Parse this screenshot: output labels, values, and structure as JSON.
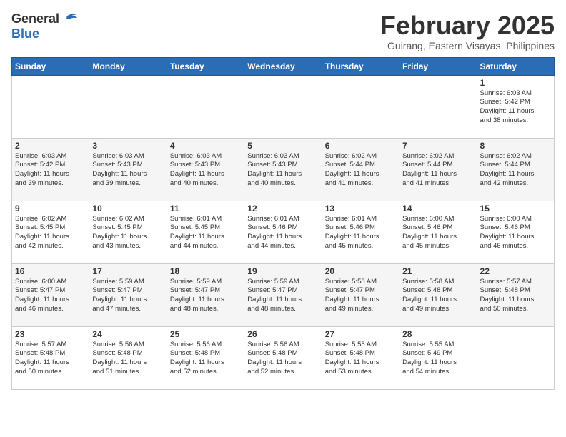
{
  "header": {
    "logo": {
      "general": "General",
      "blue": "Blue"
    },
    "title": "February 2025",
    "location": "Guirang, Eastern Visayas, Philippines"
  },
  "weekdays": [
    "Sunday",
    "Monday",
    "Tuesday",
    "Wednesday",
    "Thursday",
    "Friday",
    "Saturday"
  ],
  "weeks": [
    [
      {
        "day": "",
        "info": ""
      },
      {
        "day": "",
        "info": ""
      },
      {
        "day": "",
        "info": ""
      },
      {
        "day": "",
        "info": ""
      },
      {
        "day": "",
        "info": ""
      },
      {
        "day": "",
        "info": ""
      },
      {
        "day": "1",
        "info": "Sunrise: 6:03 AM\nSunset: 5:42 PM\nDaylight: 11 hours\nand 38 minutes."
      }
    ],
    [
      {
        "day": "2",
        "info": "Sunrise: 6:03 AM\nSunset: 5:42 PM\nDaylight: 11 hours\nand 39 minutes."
      },
      {
        "day": "3",
        "info": "Sunrise: 6:03 AM\nSunset: 5:43 PM\nDaylight: 11 hours\nand 39 minutes."
      },
      {
        "day": "4",
        "info": "Sunrise: 6:03 AM\nSunset: 5:43 PM\nDaylight: 11 hours\nand 40 minutes."
      },
      {
        "day": "5",
        "info": "Sunrise: 6:03 AM\nSunset: 5:43 PM\nDaylight: 11 hours\nand 40 minutes."
      },
      {
        "day": "6",
        "info": "Sunrise: 6:02 AM\nSunset: 5:44 PM\nDaylight: 11 hours\nand 41 minutes."
      },
      {
        "day": "7",
        "info": "Sunrise: 6:02 AM\nSunset: 5:44 PM\nDaylight: 11 hours\nand 41 minutes."
      },
      {
        "day": "8",
        "info": "Sunrise: 6:02 AM\nSunset: 5:44 PM\nDaylight: 11 hours\nand 42 minutes."
      }
    ],
    [
      {
        "day": "9",
        "info": "Sunrise: 6:02 AM\nSunset: 5:45 PM\nDaylight: 11 hours\nand 42 minutes."
      },
      {
        "day": "10",
        "info": "Sunrise: 6:02 AM\nSunset: 5:45 PM\nDaylight: 11 hours\nand 43 minutes."
      },
      {
        "day": "11",
        "info": "Sunrise: 6:01 AM\nSunset: 5:45 PM\nDaylight: 11 hours\nand 44 minutes."
      },
      {
        "day": "12",
        "info": "Sunrise: 6:01 AM\nSunset: 5:46 PM\nDaylight: 11 hours\nand 44 minutes."
      },
      {
        "day": "13",
        "info": "Sunrise: 6:01 AM\nSunset: 5:46 PM\nDaylight: 11 hours\nand 45 minutes."
      },
      {
        "day": "14",
        "info": "Sunrise: 6:00 AM\nSunset: 5:46 PM\nDaylight: 11 hours\nand 45 minutes."
      },
      {
        "day": "15",
        "info": "Sunrise: 6:00 AM\nSunset: 5:46 PM\nDaylight: 11 hours\nand 46 minutes."
      }
    ],
    [
      {
        "day": "16",
        "info": "Sunrise: 6:00 AM\nSunset: 5:47 PM\nDaylight: 11 hours\nand 46 minutes."
      },
      {
        "day": "17",
        "info": "Sunrise: 5:59 AM\nSunset: 5:47 PM\nDaylight: 11 hours\nand 47 minutes."
      },
      {
        "day": "18",
        "info": "Sunrise: 5:59 AM\nSunset: 5:47 PM\nDaylight: 11 hours\nand 48 minutes."
      },
      {
        "day": "19",
        "info": "Sunrise: 5:59 AM\nSunset: 5:47 PM\nDaylight: 11 hours\nand 48 minutes."
      },
      {
        "day": "20",
        "info": "Sunrise: 5:58 AM\nSunset: 5:47 PM\nDaylight: 11 hours\nand 49 minutes."
      },
      {
        "day": "21",
        "info": "Sunrise: 5:58 AM\nSunset: 5:48 PM\nDaylight: 11 hours\nand 49 minutes."
      },
      {
        "day": "22",
        "info": "Sunrise: 5:57 AM\nSunset: 5:48 PM\nDaylight: 11 hours\nand 50 minutes."
      }
    ],
    [
      {
        "day": "23",
        "info": "Sunrise: 5:57 AM\nSunset: 5:48 PM\nDaylight: 11 hours\nand 50 minutes."
      },
      {
        "day": "24",
        "info": "Sunrise: 5:56 AM\nSunset: 5:48 PM\nDaylight: 11 hours\nand 51 minutes."
      },
      {
        "day": "25",
        "info": "Sunrise: 5:56 AM\nSunset: 5:48 PM\nDaylight: 11 hours\nand 52 minutes."
      },
      {
        "day": "26",
        "info": "Sunrise: 5:56 AM\nSunset: 5:48 PM\nDaylight: 11 hours\nand 52 minutes."
      },
      {
        "day": "27",
        "info": "Sunrise: 5:55 AM\nSunset: 5:48 PM\nDaylight: 11 hours\nand 53 minutes."
      },
      {
        "day": "28",
        "info": "Sunrise: 5:55 AM\nSunset: 5:49 PM\nDaylight: 11 hours\nand 54 minutes."
      },
      {
        "day": "",
        "info": ""
      }
    ]
  ]
}
